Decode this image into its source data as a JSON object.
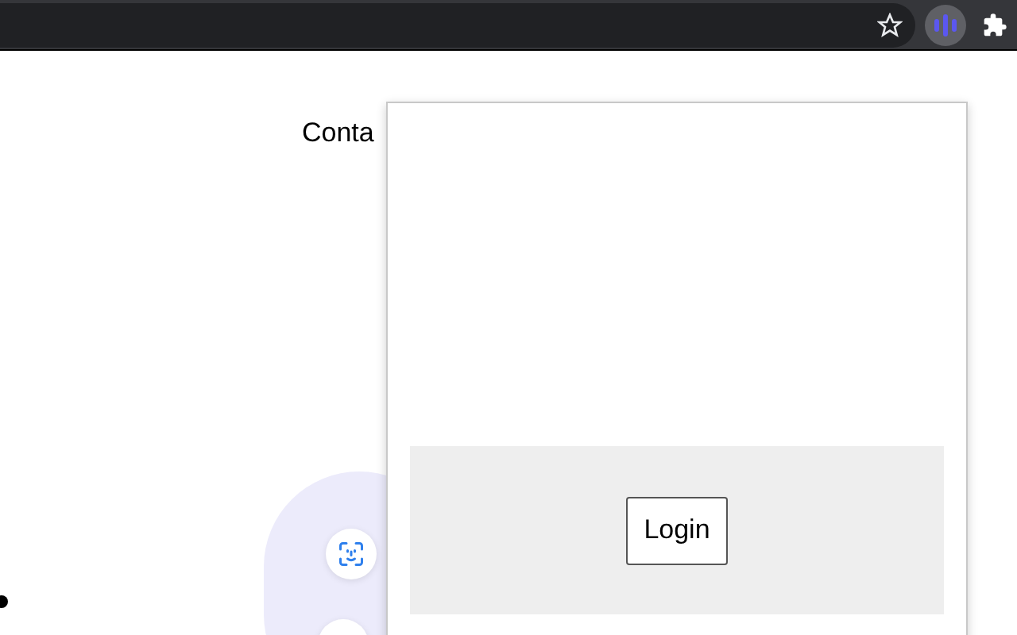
{
  "page": {
    "heading": "Conta"
  },
  "popup": {
    "button": "Login"
  }
}
